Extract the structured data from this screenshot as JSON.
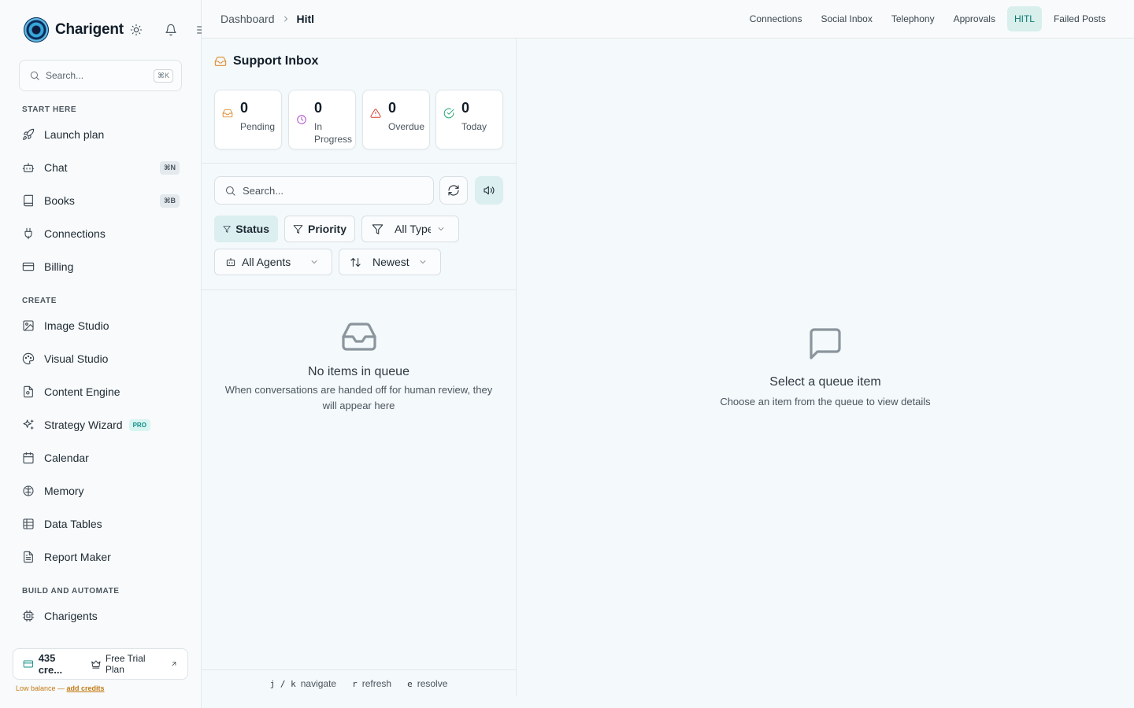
{
  "sidebar": {
    "brand": "Charigent",
    "search": {
      "placeholder": "Search...",
      "shortcut": "⌘K"
    },
    "sections": [
      {
        "title": "START HERE"
      },
      {
        "title": "CREATE"
      },
      {
        "title": "BUILD AND AUTOMATE"
      }
    ],
    "items": [
      {
        "label": "Launch plan",
        "icon": "rocket-icon"
      },
      {
        "label": "Chat",
        "icon": "bot-icon",
        "shortcut": "⌘N"
      },
      {
        "label": "Books",
        "icon": "book-icon",
        "shortcut": "⌘B"
      },
      {
        "label": "Connections",
        "icon": "plug-icon"
      },
      {
        "label": "Billing",
        "icon": "credit-card-icon"
      },
      {
        "label": "Image Studio",
        "icon": "image-icon"
      },
      {
        "label": "Visual Studio",
        "icon": "palette-icon"
      },
      {
        "label": "Content Engine",
        "icon": "file-icon"
      },
      {
        "label": "Strategy Wizard",
        "icon": "sparkles-icon",
        "badge": "PRO"
      },
      {
        "label": "Calendar",
        "icon": "calendar-icon"
      },
      {
        "label": "Memory",
        "icon": "brain-icon"
      },
      {
        "label": "Data Tables",
        "icon": "table-icon"
      },
      {
        "label": "Report Maker",
        "icon": "report-icon"
      },
      {
        "label": "Charigents",
        "icon": "cpu-icon"
      }
    ],
    "credits": {
      "amount": "435 cre...",
      "plan": "Free Trial Plan"
    },
    "low_balance": {
      "text": "Low balance — ",
      "link": "add credits"
    }
  },
  "header": {
    "breadcrumb": [
      "Dashboard",
      "Hitl"
    ],
    "tabs": [
      "Connections",
      "Social Inbox",
      "Telephony",
      "Approvals",
      "HITL",
      "Failed Posts"
    ],
    "active_tab": "HITL"
  },
  "inbox": {
    "title": "Support Inbox",
    "stats": [
      {
        "value": "0",
        "label": "Pending",
        "color": "#e08a2b"
      },
      {
        "value": "0",
        "label": "In Progress",
        "color": "#a23cc4"
      },
      {
        "value": "0",
        "label": "Overdue",
        "color": "#d8392b"
      },
      {
        "value": "0",
        "label": "Today",
        "color": "#18a06b"
      }
    ],
    "search_placeholder": "Search...",
    "filters": {
      "status": "Status",
      "priority": "Priority",
      "type": "All Type",
      "agents": "All Agents",
      "sort": "Newest"
    },
    "empty": {
      "title": "No items in queue",
      "text": "When conversations are handed off for human review, they will appear here"
    },
    "shortcuts": [
      {
        "keys": "j / k",
        "label": "navigate"
      },
      {
        "keys": "r",
        "label": "refresh"
      },
      {
        "keys": "e",
        "label": "resolve"
      }
    ]
  },
  "detail": {
    "title": "Select a queue item",
    "text": "Choose an item from the queue to view details"
  },
  "colors": {
    "accent": "#0f7a72",
    "active_tab_bg": "#d8efeb"
  }
}
